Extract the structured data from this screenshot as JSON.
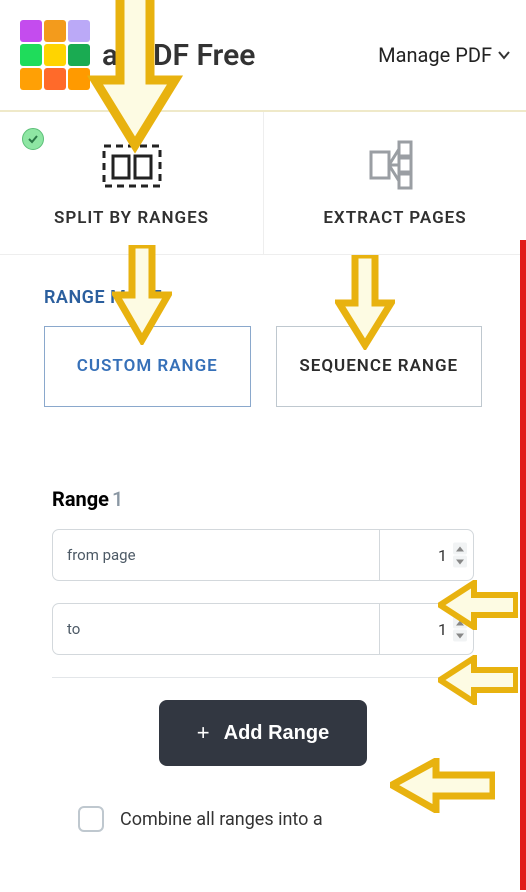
{
  "header": {
    "app_title_suffix": "allPDF Free",
    "manage_label": "Manage PDF"
  },
  "tabs": {
    "split": "SPLIT BY RANGES",
    "extract": "EXTRACT PAGES"
  },
  "range_mode_label": "RANGE MODE:",
  "mode": {
    "custom": "CUSTOM RANGE",
    "sequence": "SEQUENCE RANGE"
  },
  "range": {
    "label_prefix": "Range",
    "number": "1",
    "from_label": "from page",
    "from_value": "1",
    "to_label": "to",
    "to_value": "1"
  },
  "add_button": "Add Range",
  "combine_label": "Combine all ranges into a"
}
